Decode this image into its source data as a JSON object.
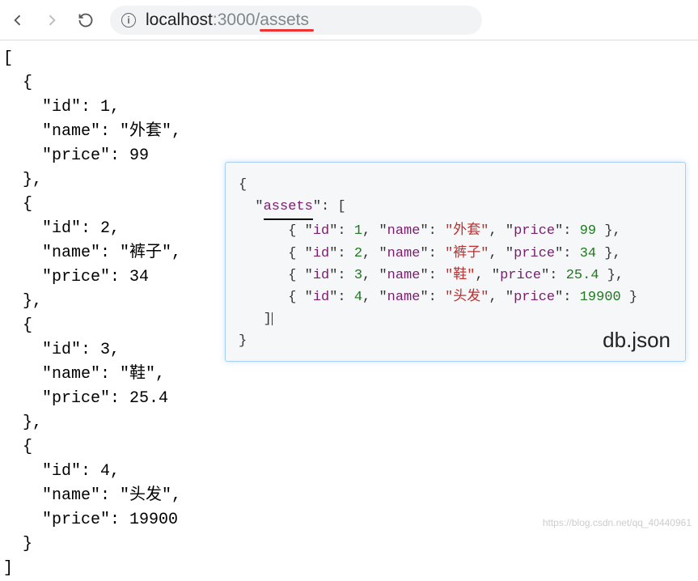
{
  "browser": {
    "url_host": "localhost",
    "url_port": ":3000/",
    "url_path": "assets"
  },
  "json_response": [
    {
      "id": 1,
      "name": "外套",
      "price": 99
    },
    {
      "id": 2,
      "name": "裤子",
      "price": 34
    },
    {
      "id": 3,
      "name": "鞋",
      "price": 25.4
    },
    {
      "id": 4,
      "name": "头发",
      "price": 19900
    }
  ],
  "card": {
    "label": "db.json",
    "root_key": "assets",
    "items": [
      {
        "id": 1,
        "name": "外套",
        "price": 99
      },
      {
        "id": 2,
        "name": "裤子",
        "price": 34
      },
      {
        "id": 3,
        "name": "鞋",
        "price": 25.4
      },
      {
        "id": 4,
        "name": "头发",
        "price": 19900
      }
    ]
  },
  "watermark": "https://blog.csdn.net/qq_40440961"
}
